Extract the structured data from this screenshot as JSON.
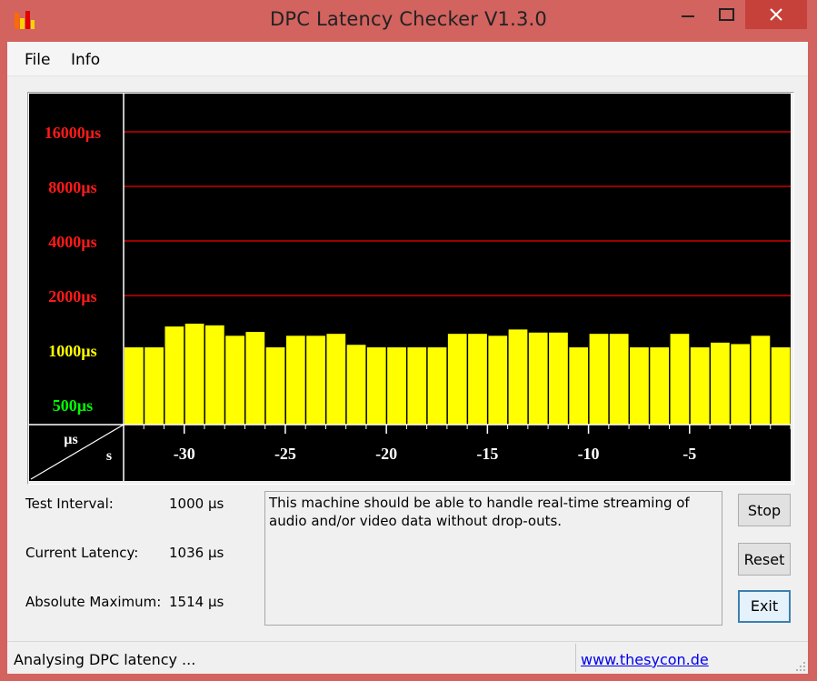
{
  "window": {
    "title": "DPC Latency Checker V1.3.0"
  },
  "menu": {
    "items": [
      "File",
      "Info"
    ]
  },
  "chart_data": {
    "type": "bar",
    "y_scale": "log",
    "y_ticks": [
      {
        "label": "16000µs",
        "value": 16000,
        "color": "#ff1a1a"
      },
      {
        "label": "8000µs",
        "value": 8000,
        "color": "#ff1a1a"
      },
      {
        "label": "4000µs",
        "value": 4000,
        "color": "#ff1a1a"
      },
      {
        "label": "2000µs",
        "value": 2000,
        "color": "#ff1a1a"
      },
      {
        "label": "1000µs",
        "value": 1000,
        "color": "#ffff00"
      },
      {
        "label": "500µs",
        "value": 500,
        "color": "#00ff00"
      }
    ],
    "x_ticks": [
      "-30",
      "-25",
      "-20",
      "-15",
      "-10",
      "-5"
    ],
    "x_tick_values": [
      -30,
      -25,
      -20,
      -15,
      -10,
      -5
    ],
    "xlim": [
      -33,
      0
    ],
    "corner_labels": {
      "y_unit": "µs",
      "x_unit": "s"
    },
    "bar_color": "#ffff00",
    "grid_color": "#cc0000",
    "values": [
      1036,
      1036,
      1350,
      1400,
      1370,
      1200,
      1260,
      1036,
      1200,
      1200,
      1230,
      1070,
      1036,
      1036,
      1036,
      1036,
      1230,
      1230,
      1200,
      1300,
      1250,
      1250,
      1036,
      1230,
      1230,
      1036,
      1036,
      1230,
      1036,
      1100,
      1080,
      1200,
      1036
    ]
  },
  "info": {
    "test_interval_label": "Test Interval:",
    "test_interval_value": "1000 µs",
    "current_latency_label": "Current Latency:",
    "current_latency_value": "1036 µs",
    "absolute_max_label": "Absolute Maximum:",
    "absolute_max_value": "1514 µs"
  },
  "message": "This machine should be able to handle real-time streaming of audio and/or video data without drop-outs.",
  "buttons": {
    "stop": "Stop",
    "reset": "Reset",
    "exit": "Exit"
  },
  "status": {
    "text": "Analysing DPC latency ...",
    "link": "www.thesycon.de"
  }
}
